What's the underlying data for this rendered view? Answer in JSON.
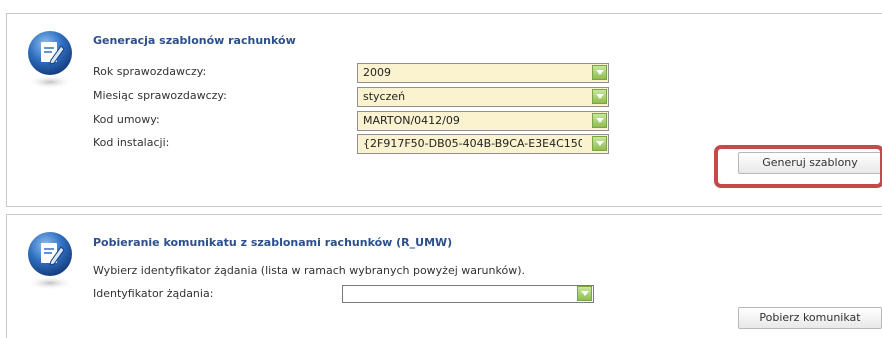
{
  "section1": {
    "title": "Generacja szablonów rachunków",
    "fields": {
      "rok_label": "Rok sprawozdawczy:",
      "rok_value": "2009",
      "miesiac_label": "Miesiąc sprawozdawczy:",
      "miesiac_value": "styczeń",
      "kod_umowy_label": "Kod umowy:",
      "kod_umowy_value": "MARTON/0412/09",
      "kod_instalacji_label": "Kod instalacji:",
      "kod_instalacji_value": "{2F917F50-DB05-404B-B9CA-E3E4C150"
    },
    "button_label": "Generuj szablony"
  },
  "section2": {
    "title": "Pobieranie komunikatu z szablonami rachunków (R_UMW)",
    "description": "Wybierz identyfikator żądania (lista w ramach wybranych powyżej warunków).",
    "id_label": "Identyfikator żądania:",
    "id_value": "",
    "button_label": "Pobierz komunikat"
  },
  "colors": {
    "title": "#2b4f8c",
    "select_bg": "#fbf3d0",
    "highlight": "#c44a4a",
    "arrow_green": "#8fbf4e"
  },
  "icons": {
    "panel_icon": "edit-document-icon",
    "select_arrow": "chevron-down-icon"
  }
}
